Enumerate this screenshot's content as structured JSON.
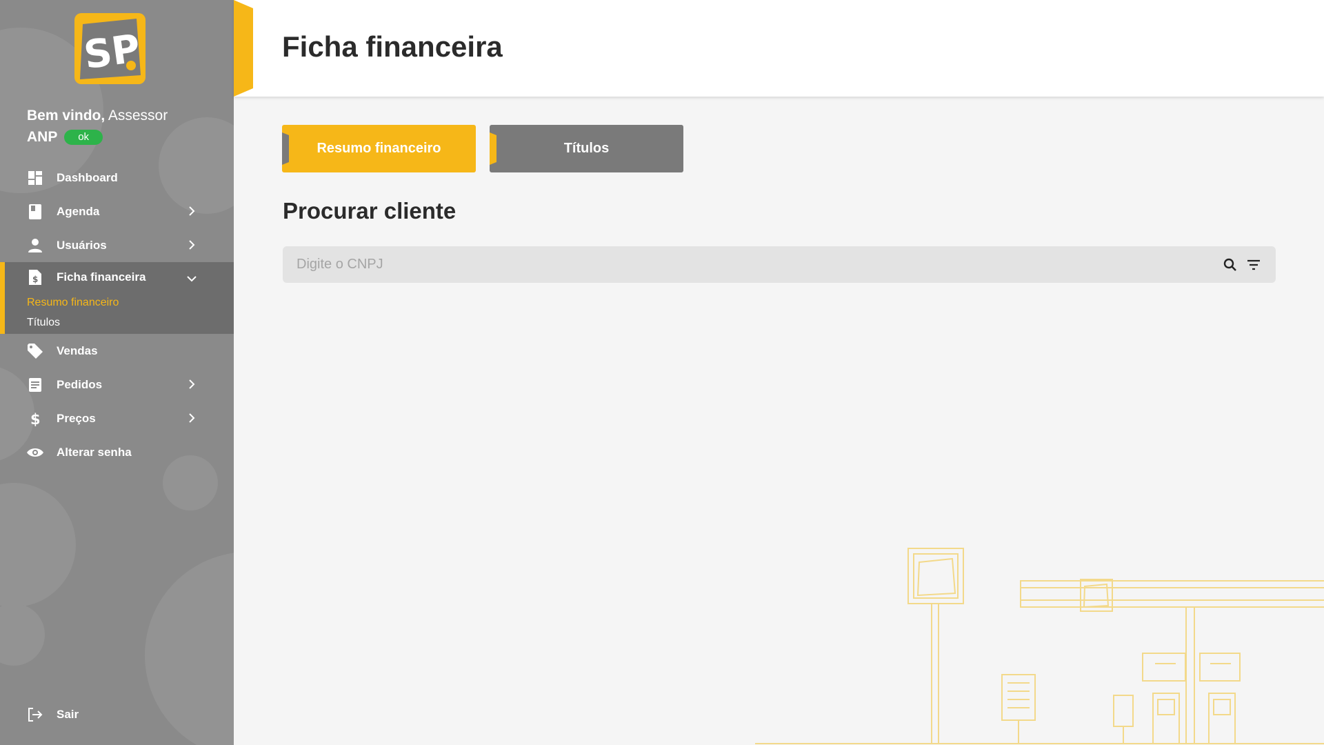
{
  "sidebar": {
    "greeting_bold": "Bem vindo,",
    "greeting_name": "Assessor",
    "user_org": "ANP",
    "status_badge": "ok",
    "items": [
      {
        "label": "Dashboard",
        "icon": "dashboard-icon"
      },
      {
        "label": "Agenda",
        "icon": "book-icon"
      },
      {
        "label": "Usuários",
        "icon": "person-icon"
      },
      {
        "label": "Ficha financeira",
        "icon": "document-dollar-icon",
        "expanded": true,
        "children": [
          {
            "label": "Resumo financeiro",
            "active": true
          },
          {
            "label": "Títulos",
            "active": false
          }
        ]
      },
      {
        "label": "Vendas",
        "icon": "tag-icon"
      },
      {
        "label": "Pedidos",
        "icon": "document-icon"
      },
      {
        "label": "Preços",
        "icon": "dollar-icon"
      },
      {
        "label": "Alterar senha",
        "icon": "eye-icon"
      }
    ],
    "logout_label": "Sair"
  },
  "header": {
    "title": "Ficha financeira"
  },
  "tabs": [
    {
      "label": "Resumo financeiro",
      "active": true
    },
    {
      "label": "Títulos",
      "active": false
    }
  ],
  "search_section": {
    "title": "Procurar cliente",
    "placeholder": "Digite o CNPJ",
    "value": ""
  },
  "colors": {
    "accent": "#f6b718",
    "sidebar_bg": "#8a8a8a",
    "sidebar_active_bg": "#6d6d6d",
    "status_ok": "#2db34a",
    "tab_inactive": "#7a7a7a"
  }
}
